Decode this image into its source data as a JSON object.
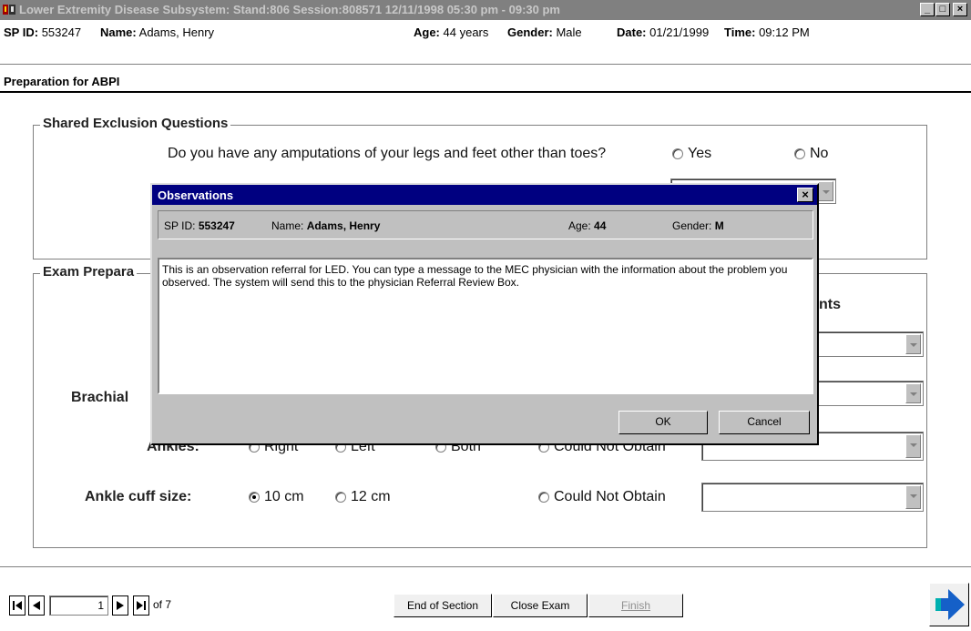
{
  "window": {
    "title": "Lower Extremity Disease Subsystem: Stand:806 Session:808571 12/11/1998 05:30 pm - 09:30 pm",
    "controls": [
      "_",
      "□",
      "×"
    ]
  },
  "participant": {
    "sp_id_label": "SP ID:",
    "sp_id": "553247",
    "name_label": "Name:",
    "name": "Adams, Henry",
    "age_label": "Age:",
    "age": "44 years",
    "gender_label": "Gender:",
    "gender": "Male",
    "date_label": "Date:",
    "date": "01/21/1999",
    "time_label": "Time:",
    "time": "09:12 PM"
  },
  "section": {
    "title": "Preparation for ABPI"
  },
  "shared_exclusion": {
    "legend": "Shared Exclusion Questions",
    "question": "Do you have any amputations of your legs and feet other than toes?",
    "options": [
      "Yes",
      "No"
    ]
  },
  "exam_prep": {
    "legend": "Exam Prepara",
    "comments_header": "nts",
    "brachial_label": "Brachial",
    "ankles_label": "Ankles:",
    "ankle_options": [
      "Right",
      "Left",
      "Both",
      "Could Not Obtain"
    ],
    "ankle_cuff_label": "Ankle cuff size:",
    "ankle_cuff_options": [
      "10 cm",
      "12 cm",
      "Could Not Obtain"
    ],
    "ankle_cuff_selected": "10 cm"
  },
  "dialog": {
    "title": "Observations",
    "close": "×",
    "sp_id_label": "SP ID:",
    "sp_id": "553247",
    "name_label": "Name:",
    "name": "Adams, Henry",
    "age_label": "Age:",
    "age": "44",
    "gender_label": "Gender:",
    "gender": "M",
    "message": "This is an observation referral for LED.  You can type a message to the MEC physician with the information about the problem you observed.  The system will send this to the physician Referral Review Box.",
    "ok_label": "OK",
    "cancel_label": "Cancel"
  },
  "footer": {
    "page": "1",
    "of_label": "of 7",
    "end_section_label": "End of Section",
    "close_exam_label": "Close Exam",
    "finish_label": "Finish"
  },
  "colors": {
    "titlebar_inactive": "#808080",
    "dialog_titlebar": "#000080",
    "next_arrow": "#1560c8",
    "next_arrow_tail": "#00b0b0"
  }
}
